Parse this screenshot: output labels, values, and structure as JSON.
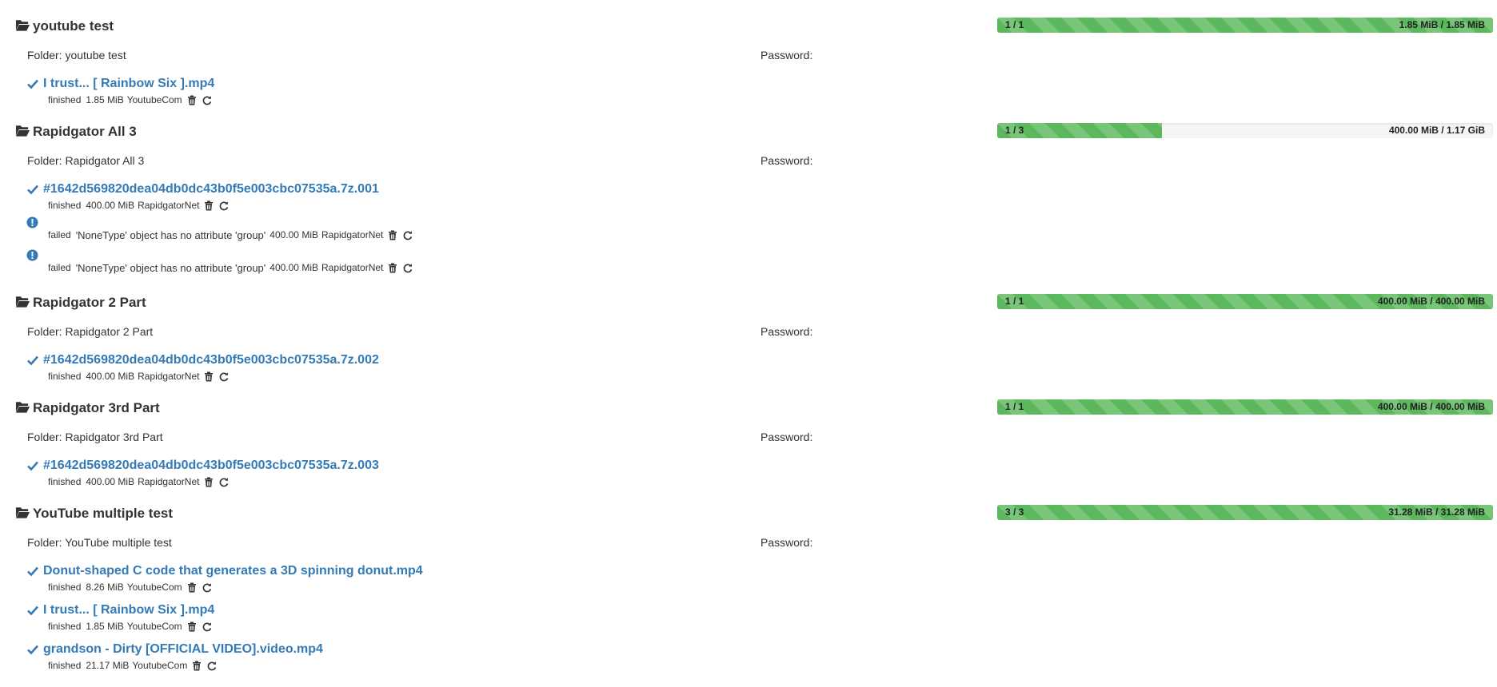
{
  "colors": {
    "link": "#337ab7",
    "progress_fill": "#5cb85c",
    "progress_track": "#f5f5f5"
  },
  "icons": {
    "folder": "folder-open-icon",
    "finished": "check-icon",
    "failed": "exclamation-circle-icon",
    "delete": "trash-icon",
    "restart": "refresh-icon"
  },
  "packages": [
    {
      "name": "youtube test",
      "progress": {
        "count_label": "1 / 1",
        "size_label": "1.85 MiB / 1.85 MiB",
        "fraction": 1.0
      },
      "folder_label": "Folder: youtube test",
      "password_label": "Password:",
      "links": [
        {
          "name": "I trust... [ Rainbow Six ].mp4",
          "status": "finished",
          "size": "1.85 MiB",
          "plugin": "YoutubeCom"
        }
      ]
    },
    {
      "name": "Rapidgator All 3",
      "progress": {
        "count_label": "1 / 3",
        "size_label": "400.00 MiB / 1.17 GiB",
        "fraction": 0.333
      },
      "folder_label": "Folder: Rapidgator All 3",
      "password_label": "Password:",
      "links": [
        {
          "name": "#1642d569820dea04db0dc43b0f5e003cbc07535a.7z.001",
          "status": "finished",
          "size": "400.00 MiB",
          "plugin": "RapidgatorNet"
        },
        {
          "name": "",
          "status": "failed",
          "error": "'NoneType' object has no attribute 'group'",
          "size": "400.00 MiB",
          "plugin": "RapidgatorNet"
        },
        {
          "name": "",
          "status": "failed",
          "error": "'NoneType' object has no attribute 'group'",
          "size": "400.00 MiB",
          "plugin": "RapidgatorNet"
        }
      ]
    },
    {
      "name": "Rapidgator 2 Part",
      "progress": {
        "count_label": "1 / 1",
        "size_label": "400.00 MiB / 400.00 MiB",
        "fraction": 1.0
      },
      "folder_label": "Folder: Rapidgator 2 Part",
      "password_label": "Password:",
      "links": [
        {
          "name": "#1642d569820dea04db0dc43b0f5e003cbc07535a.7z.002",
          "status": "finished",
          "size": "400.00 MiB",
          "plugin": "RapidgatorNet"
        }
      ]
    },
    {
      "name": "Rapidgator 3rd Part",
      "progress": {
        "count_label": "1 / 1",
        "size_label": "400.00 MiB / 400.00 MiB",
        "fraction": 1.0
      },
      "folder_label": "Folder: Rapidgator 3rd Part",
      "password_label": "Password:",
      "links": [
        {
          "name": "#1642d569820dea04db0dc43b0f5e003cbc07535a.7z.003",
          "status": "finished",
          "size": "400.00 MiB",
          "plugin": "RapidgatorNet"
        }
      ]
    },
    {
      "name": "YouTube multiple test",
      "progress": {
        "count_label": "3 / 3",
        "size_label": "31.28 MiB / 31.28 MiB",
        "fraction": 1.0
      },
      "folder_label": "Folder: YouTube multiple test",
      "password_label": "Password:",
      "links": [
        {
          "name": "Donut-shaped C code that generates a 3D spinning donut.mp4",
          "status": "finished",
          "size": "8.26 MiB",
          "plugin": "YoutubeCom"
        },
        {
          "name": "I trust... [ Rainbow Six ].mp4",
          "status": "finished",
          "size": "1.85 MiB",
          "plugin": "YoutubeCom"
        },
        {
          "name": "grandson - Dirty [OFFICIAL VIDEO].video.mp4",
          "status": "finished",
          "size": "21.17 MiB",
          "plugin": "YoutubeCom"
        }
      ]
    }
  ]
}
